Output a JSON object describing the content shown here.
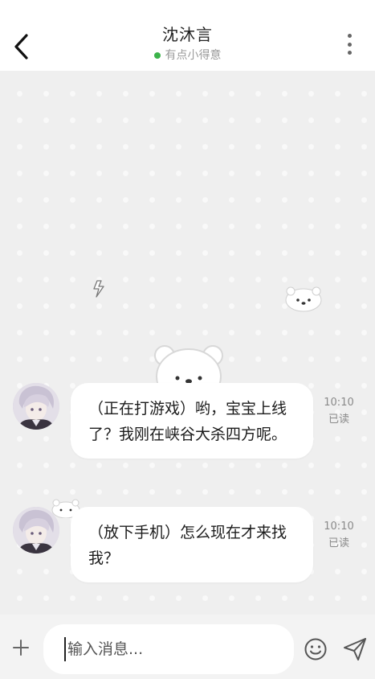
{
  "header": {
    "back_icon": "chevron-left-icon",
    "title": "沈沐言",
    "status": "有点小得意",
    "status_color": "#3cb34a",
    "more_icon": "more-vertical-icon"
  },
  "messages": [
    {
      "text": "（正在打游戏）哟，宝宝上线了？我刚在峡谷大杀四方呢。",
      "time": "10:10",
      "read": "已读"
    },
    {
      "text": "（放下手机）怎么现在才来找我？",
      "time": "10:10",
      "read": "已读"
    }
  ],
  "input": {
    "placeholder": "输入消息...",
    "plus_icon": "plus-icon",
    "emoji_icon": "smile-icon",
    "send_icon": "send-icon"
  },
  "colors": {
    "chat_background": "#efefef",
    "bubble": "#ffffff"
  }
}
